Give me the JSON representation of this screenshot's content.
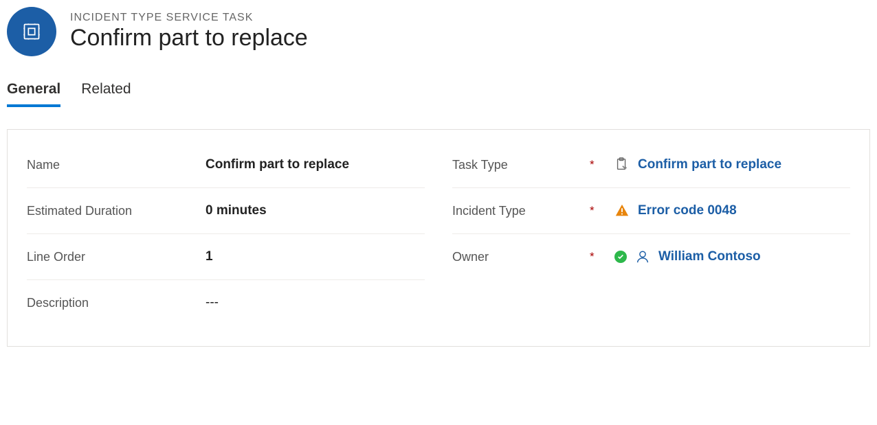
{
  "header": {
    "subtitle": "INCIDENT TYPE SERVICE TASK",
    "title": "Confirm part to replace"
  },
  "tabs": {
    "general": "General",
    "related": "Related"
  },
  "fields": {
    "name_label": "Name",
    "name_value": "Confirm part to replace",
    "estimated_duration_label": "Estimated Duration",
    "estimated_duration_value": "0 minutes",
    "line_order_label": "Line Order",
    "line_order_value": "1",
    "description_label": "Description",
    "description_value": "---",
    "task_type_label": "Task Type",
    "task_type_value": "Confirm part to replace",
    "incident_type_label": "Incident Type",
    "incident_type_value": "Error code 0048",
    "owner_label": "Owner",
    "owner_value": "William Contoso"
  },
  "_required_marker": "*"
}
